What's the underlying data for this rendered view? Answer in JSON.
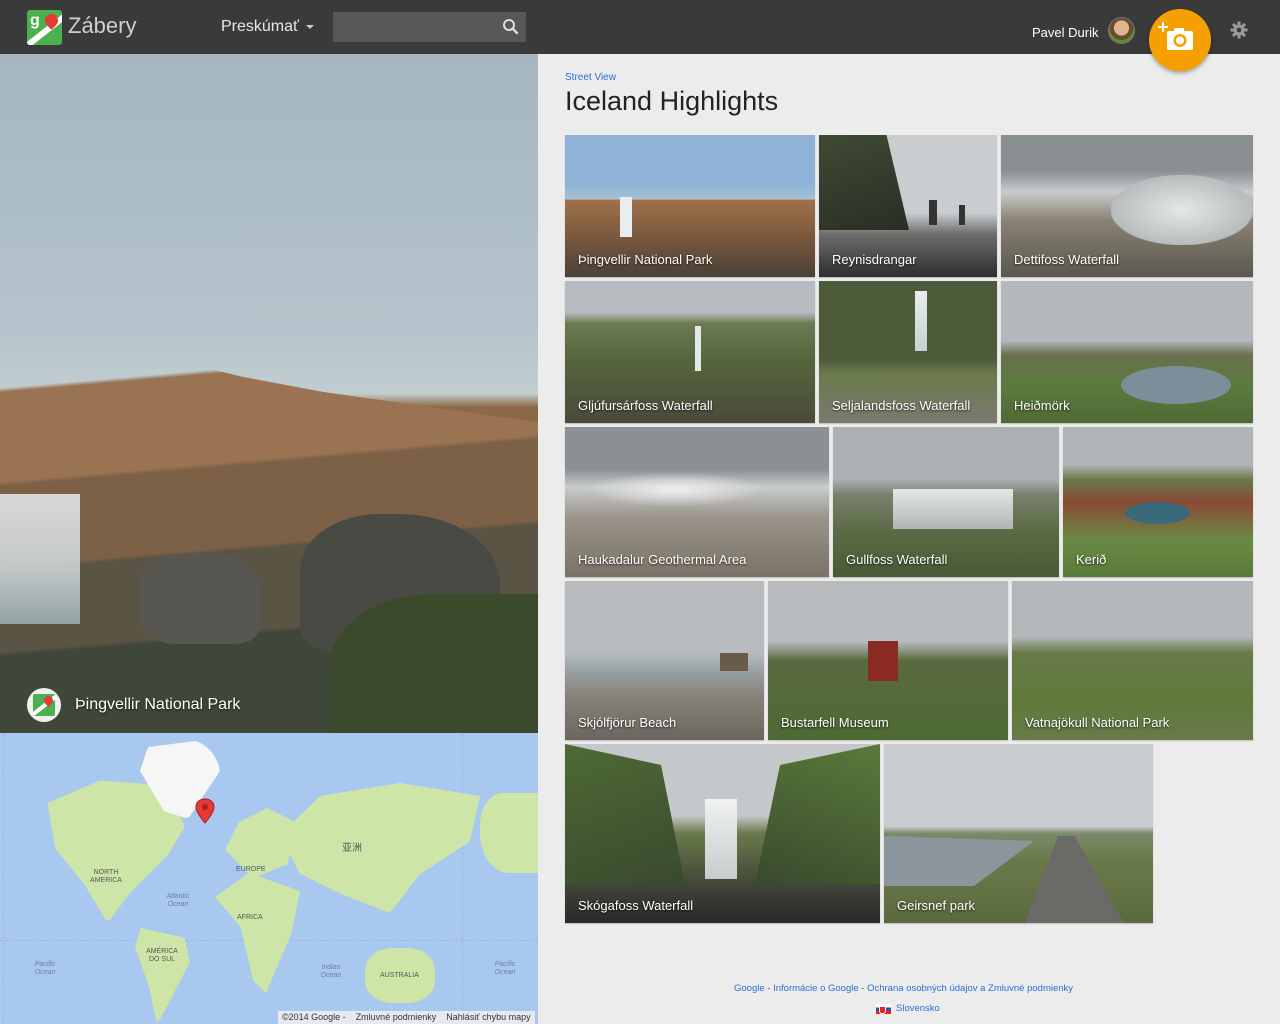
{
  "header": {
    "app_title": "Zábery",
    "explore_label": "Preskúmať",
    "search": {
      "value": "",
      "placeholder": ""
    },
    "user_name": "Pavel Durik"
  },
  "hero": {
    "caption": "Þingvellir National Park"
  },
  "map": {
    "labels": {
      "north_america": "NORTH AMERICA",
      "europe": "EUROPE",
      "asia": "亚洲",
      "africa": "AFRICA",
      "south_america": "AMÉRICA DO SUL",
      "australia": "AUSTRALIA",
      "atlantic": "Atlantic Ocean",
      "pacific_left": "Pacific Ocean",
      "pacific_right": "Pacific Ocean",
      "indian": "Indian Ocean"
    },
    "footer": {
      "copyright": "©2014 Google -",
      "terms": "Zmluvné podmienky",
      "report": "Nahlásiť chybu mapy"
    }
  },
  "content": {
    "breadcrumb": "Street View",
    "title": "Iceland Highlights",
    "tiles": [
      {
        "caption": "Þingvellir National Park"
      },
      {
        "caption": "Reynisdrangar"
      },
      {
        "caption": "Dettifoss Waterfall"
      },
      {
        "caption": "Gljúfursárfoss Waterfall"
      },
      {
        "caption": "Seljalandsfoss Waterfall"
      },
      {
        "caption": "Heiðmörk"
      },
      {
        "caption": "Haukadalur Geothermal Area"
      },
      {
        "caption": "Gullfoss Waterfall"
      },
      {
        "caption": "Kerið"
      },
      {
        "caption": "Skjólfjörur Beach"
      },
      {
        "caption": "Bustarfell Museum"
      },
      {
        "caption": "Vatnajökull National Park"
      },
      {
        "caption": "Skógafoss Waterfall"
      },
      {
        "caption": "Geirsnef park"
      }
    ]
  },
  "footer": {
    "links": [
      "Google",
      "Informácie o Google",
      "Ochrana osobných údajov a Zmluvné podmienky"
    ],
    "separator": " - ",
    "language": "Slovensko"
  },
  "colors": {
    "topbar": "#3a3a3a",
    "accent_orange": "#f5a000",
    "link_blue": "#2a6fd8",
    "selected_outline": "#4a8af4"
  },
  "icons": {
    "search": "search-icon",
    "add_photo": "camera-plus-icon",
    "settings": "gear-icon",
    "map_pin": "map-marker-icon"
  }
}
